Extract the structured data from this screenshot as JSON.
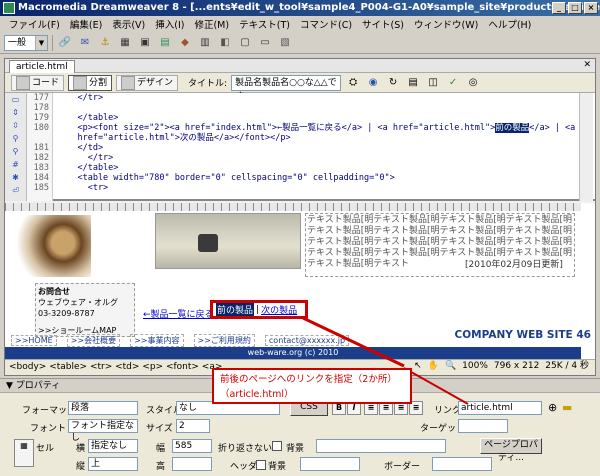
{
  "window": {
    "title": "Macromedia Dreamweaver 8 - [...ents¥edit_w_tool¥sample4_P004-G1-A0¥sample_site¥products¥article.html]",
    "buttons": [
      "_",
      "□",
      "×"
    ]
  },
  "menu": [
    "ファイル(F)",
    "編集(E)",
    "表示(V)",
    "挿入(I)",
    "修正(M)",
    "テキスト(T)",
    "コマンド(C)",
    "サイト(S)",
    "ウィンドウ(W)",
    "ヘルプ(H)"
  ],
  "toolbar": {
    "category": "一般"
  },
  "document": {
    "tab": "article.html",
    "views": {
      "code": "コード",
      "split": "分割",
      "design": "デザイン"
    },
    "title_label": "タイトル:",
    "title_value": "製品名製品名○○な△△です",
    "line_numbers": [
      "177",
      "178",
      "179",
      "180",
      "",
      "181",
      "182",
      "183",
      "184",
      "185"
    ],
    "code_lines": [
      "    </tr>",
      "",
      "    </table>",
      "    <p><font size=\"2\"><a href=\"index.html\">←製品一覧に戻る</a> | <a href=\"article.html\">",
      "    href=\"article.html\">次の製品</a></font></p>",
      "    </td>",
      "      </tr>",
      "    </table>",
      "    <table width=\"780\" border=\"0\" cellspacing=\"0\" cellpadding=\"0\">",
      "      <tr>"
    ],
    "code_highlight": "前の製品",
    "code_tail": "</a> | <a",
    "design": {
      "dummy_text": "テキスト製品[明テキスト製品[明テキスト製品[明テキスト製品[明テキスト製品[明テキスト製品[明テキスト製品[明テキスト製品[明テキスト製品[明テキスト製品[明テキスト製品[明テキスト製品[明テキスト製品[明テキスト製品[明テキスト製品[明テキスト製品[明テキスト製品[明テキスト",
      "date_text": "[2010年02月09日更新]",
      "contact_title": "お問合せ",
      "contact_company": "ウェブウェア・オルグ",
      "contact_phone": "03-3209-8787",
      "contact_map": ">>ショールームMAP",
      "prev_link": "←製品一覧に戻る",
      "selected_link": "前の製品",
      "divider": "|",
      "next_link": "次の製品",
      "nav_items": [
        ">>HOME",
        ">>会社概要",
        ">>事業内容",
        ">>ご利用規約",
        "contact@xxxxxx.jp"
      ],
      "company": "COMPANY WEB SITE 46",
      "copyright": "web-ware.org (c) 2010"
    },
    "tag_path": "<body> <table> <tr> <td> <p> <font> <a>",
    "zoom": "100%",
    "dimensions": "796 x 212",
    "size_time": "25K / 4 秒"
  },
  "annotation": {
    "line1": "前後のページへのリンクを指定（2か所）",
    "line2": "（article.html）"
  },
  "properties": {
    "header": "▼ プロパティ",
    "format_label": "フォーマット",
    "format_value": "段落",
    "style_label": "スタイル",
    "style_value": "なし",
    "css_button": "CSS",
    "link_label": "リンク",
    "link_value": "article.html",
    "font_label": "フォント",
    "font_value": "フォント指定なし",
    "size_label": "サイズ",
    "size_value": "2",
    "target_label": "ターゲット",
    "cell_label": "セル",
    "horz_label": "横",
    "horz_value": "指定なし",
    "width_label": "幅",
    "width_value": "585",
    "nowrap_label": "折り返さない",
    "bg_label": "背景",
    "page_props_button": "ページプロパティ...",
    "vert_label": "縦",
    "vert_value": "上",
    "height_label": "高",
    "header_label": "ヘッダ",
    "bg2_label": "背景",
    "border_label": "ボーダー"
  }
}
